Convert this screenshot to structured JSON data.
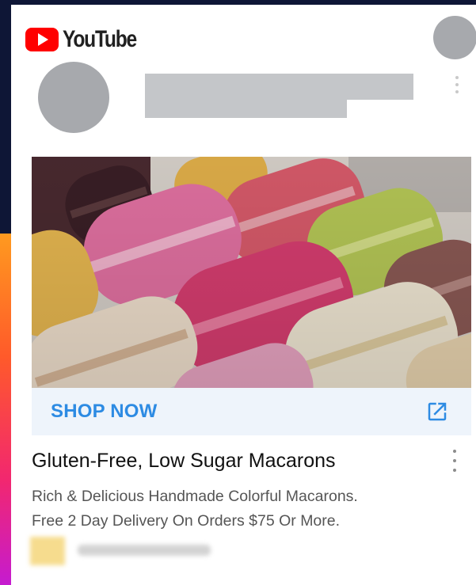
{
  "header": {
    "logo_text": "YouTube",
    "logo_icon": "youtube-play-icon",
    "brand_color": "#ff0000"
  },
  "ad": {
    "image_alt_icon": "macarons-photo",
    "cta_label": "SHOP NOW",
    "cta_icon": "external-link-icon",
    "cta_color": "#2d8be3",
    "title": "Gluten-Free, Low Sugar Macarons",
    "description_lines": [
      "Rich & Delicious Handmade Colorful Macarons.",
      "Free 2 Day Delivery On Orders $75 Or More."
    ],
    "menu_icon": "more-vert-icon"
  }
}
